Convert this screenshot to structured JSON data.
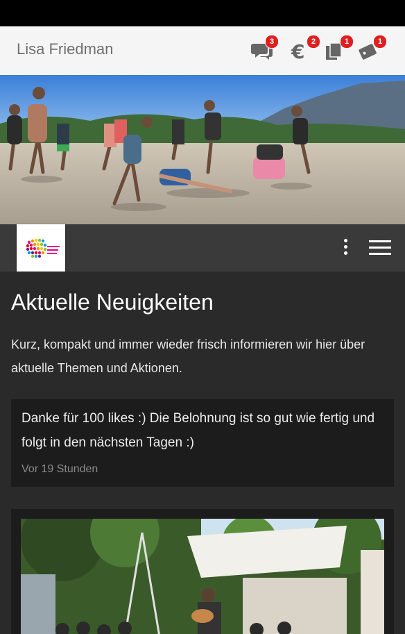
{
  "header": {
    "user_name": "Lisa Friedman",
    "notifications": [
      {
        "icon": "chat-icon",
        "count": "3"
      },
      {
        "icon": "euro-icon",
        "count": "2"
      },
      {
        "icon": "documents-icon",
        "count": "1"
      },
      {
        "icon": "tickets-icon",
        "count": "1"
      }
    ]
  },
  "main": {
    "title": "Aktuelle Neuigkeiten",
    "intro": "Kurz, kompakt und immer wieder frisch informieren wir hier über aktuelle Themen und Aktionen.",
    "posts": [
      {
        "text": "Danke für 100 likes :) Die Belohnung ist so gut wie fertig und folgt in den nächsten Tagen :)",
        "time": "Vor 19 Stunden"
      }
    ]
  },
  "colors": {
    "badge": "#e02020",
    "appbar": "#3a3a3a",
    "background": "#2a2a2a",
    "card": "#1c1c1c"
  }
}
